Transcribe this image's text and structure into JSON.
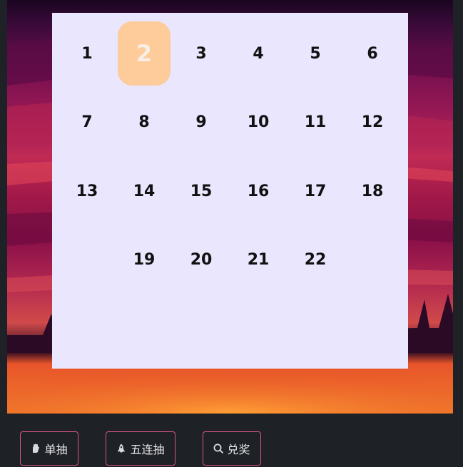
{
  "grid": {
    "numbers": [
      "1",
      "2",
      "3",
      "4",
      "5",
      "6",
      "7",
      "8",
      "9",
      "10",
      "11",
      "12",
      "13",
      "14",
      "15",
      "16",
      "17",
      "18",
      "19",
      "20",
      "21",
      "22"
    ],
    "selected": "2"
  },
  "actions": {
    "single_draw": {
      "label": "单抽",
      "icon": "hand-icon"
    },
    "five_draw": {
      "label": "五连抽",
      "icon": "rocket-icon"
    },
    "redeem": {
      "label": "兑奖",
      "icon": "search-icon"
    }
  },
  "colors": {
    "card_bg": "#e9e6fd",
    "selected_bg": "#fecb9b",
    "button_border": "#d8558a",
    "page_bg": "#1e2125"
  }
}
